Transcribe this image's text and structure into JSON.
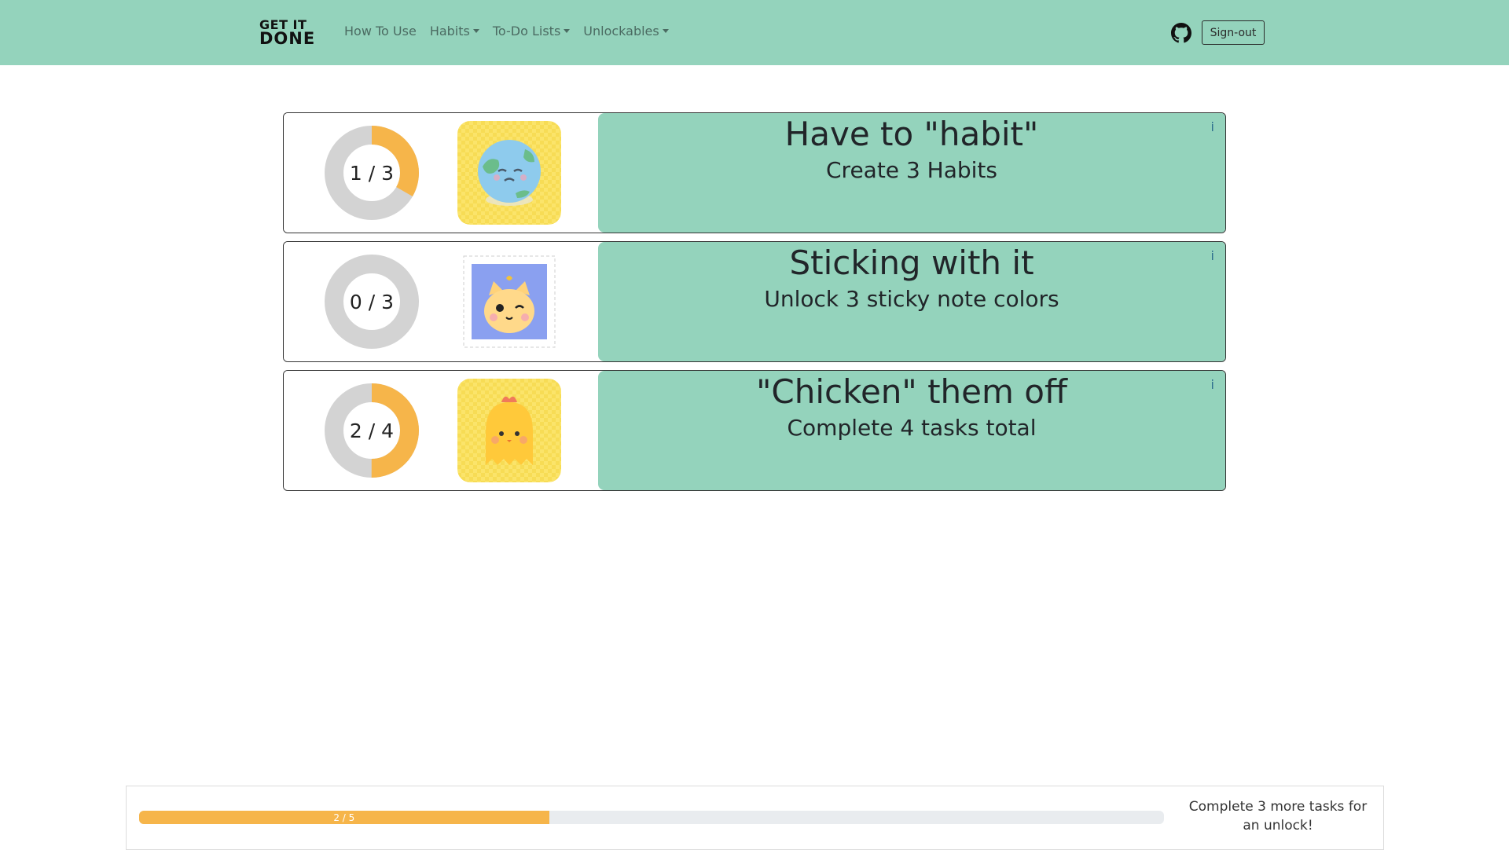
{
  "brand": {
    "line1": "GET IT",
    "line2": "DONE"
  },
  "nav": {
    "links": [
      {
        "label": "How To Use",
        "dropdown": false
      },
      {
        "label": "Habits",
        "dropdown": true
      },
      {
        "label": "To-Do Lists",
        "dropdown": true
      },
      {
        "label": "Unlockables",
        "dropdown": true
      }
    ],
    "github_icon": "github-icon",
    "signout_label": "Sign-out"
  },
  "achievements": [
    {
      "progress_label": "1 / 3",
      "progress": 0.333,
      "badge_icon": "sad-earth-badge",
      "title": "Have to \"habit\"",
      "description": "Create 3 Habits",
      "info_label": "i"
    },
    {
      "progress_label": "0 / 3",
      "progress": 0.0,
      "badge_icon": "cat-stamp-badge",
      "title": "Sticking with it",
      "description": "Unlock 3 sticky note colors",
      "info_label": "i"
    },
    {
      "progress_label": "2 / 4",
      "progress": 0.5,
      "badge_icon": "chick-badge",
      "title": "\"Chicken\" them off",
      "description": "Complete 4 tasks total",
      "info_label": "i"
    }
  ],
  "footer": {
    "progress_label": "2 / 5",
    "progress": 0.4,
    "message": "Complete 3 more tasks for an unlock!"
  },
  "colors": {
    "nav_bg": "#94d3bc",
    "accent": "#f6b54a",
    "ring_track": "#d3d3d3"
  }
}
